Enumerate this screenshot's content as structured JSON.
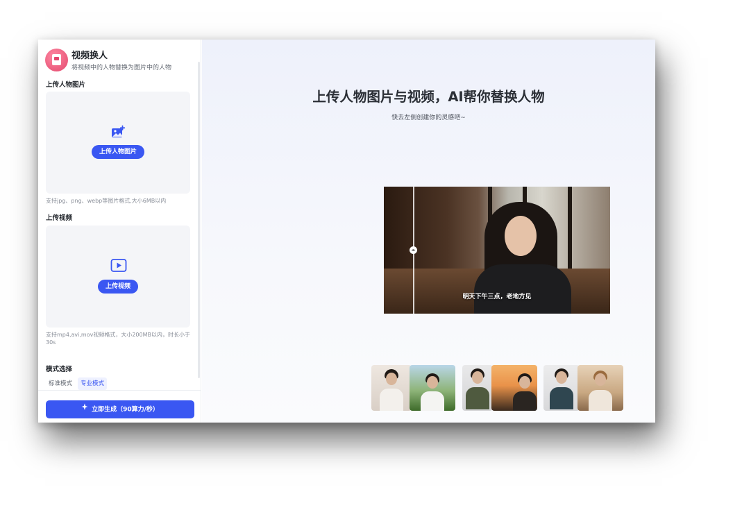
{
  "sidebar": {
    "app_title": "视频换人",
    "app_subtitle": "将视频中的人物替换为图片中的人物",
    "image_section": {
      "title": "上传人物图片",
      "button": "上传人物图片",
      "hint": "支持jpg、png、webp等图片格式,大小6MB以内"
    },
    "video_section": {
      "title": "上传视频",
      "button": "上传视频",
      "hint": "支持mp4,avi,mov视频格式，大小200MB以内，时长小于30s"
    },
    "mode_section": {
      "title": "模式选择",
      "tabs": [
        "标准模式",
        "专业模式"
      ],
      "selected": "专业模式"
    },
    "generate_button": "立即生成（90算力/秒）"
  },
  "main": {
    "title": "上传人物图片与视频，AI帮你替换人物",
    "subtitle": "快去左侧创建你的灵感吧~",
    "preview_caption": "明天下午三点，老地方见"
  },
  "icons": {
    "image_upload": "image-plus-icon",
    "video_upload": "play-square-icon",
    "generate": "sparkle-icon",
    "compare": "compare-handle-icon"
  },
  "colors": {
    "accent": "#3a57f2",
    "logo": "#e2466c"
  }
}
